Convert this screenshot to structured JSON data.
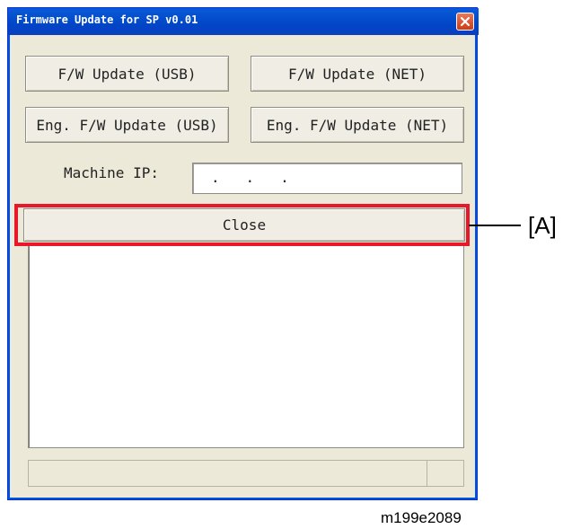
{
  "window": {
    "title": "Firmware Update for SP v0.01",
    "close_icon": "close-x-icon",
    "accent_color": "#0046c7",
    "close_color": "#d13b14"
  },
  "buttons": {
    "fw_update_usb": "F/W Update (USB)",
    "fw_update_net": "F/W Update (NET)",
    "eng_fw_update_usb": "Eng. F/W Update (USB)",
    "eng_fw_update_net": "Eng. F/W Update (NET)",
    "close": "Close"
  },
  "machine_ip": {
    "label": "Machine IP:",
    "value": ".   .   ."
  },
  "annotation": {
    "callout": "[A]",
    "highlight_color": "#e8182a",
    "figure_id": "m199e2089"
  }
}
